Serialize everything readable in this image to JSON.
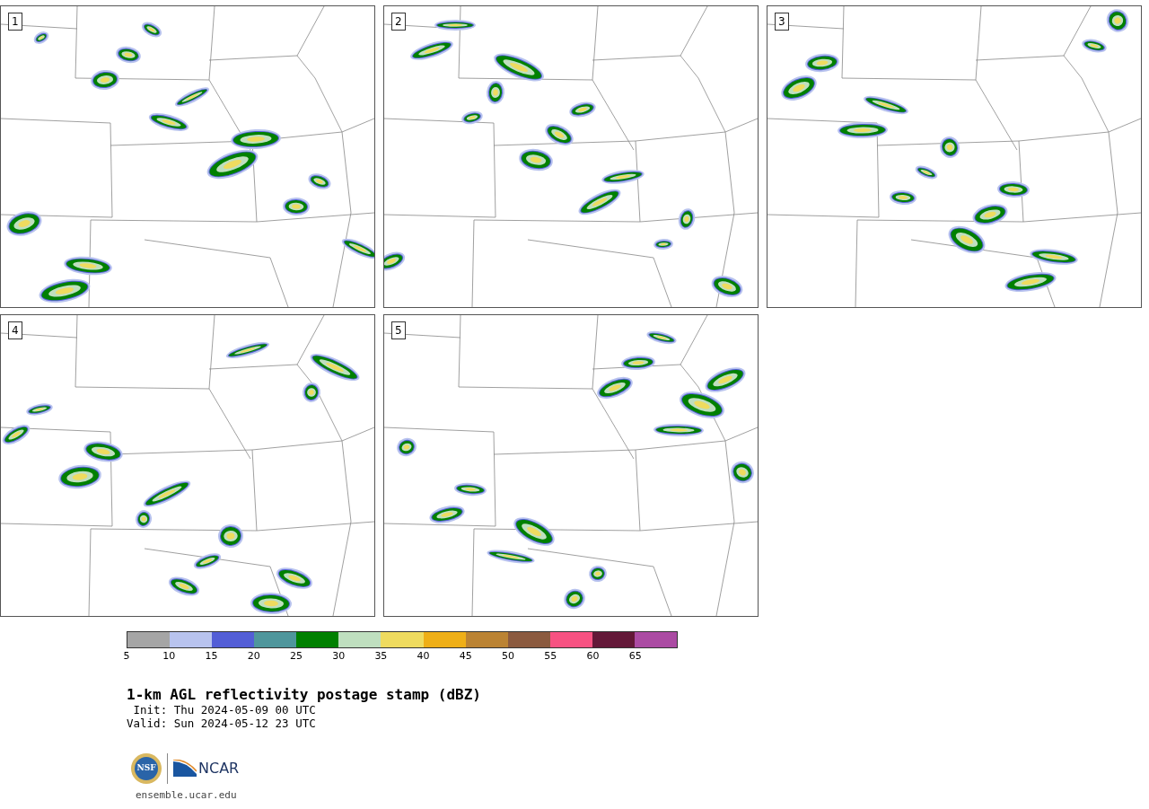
{
  "panels": [
    {
      "label": "1"
    },
    {
      "label": "2"
    },
    {
      "label": "3"
    },
    {
      "label": "4"
    },
    {
      "label": "5"
    }
  ],
  "colorbar": {
    "segments": [
      {
        "color": "#a5a5a5"
      },
      {
        "color": "#b8c3ee"
      },
      {
        "color": "#535ed6"
      },
      {
        "color": "#4f969c"
      },
      {
        "color": "#008000"
      },
      {
        "color": "#bfdfbf"
      },
      {
        "color": "#efdb5f"
      },
      {
        "color": "#efaf17"
      },
      {
        "color": "#bb8333"
      },
      {
        "color": "#8b5a3f"
      },
      {
        "color": "#f75282"
      },
      {
        "color": "#631838"
      },
      {
        "color": "#ab4ba3"
      }
    ],
    "ticks": [
      "5",
      "10",
      "15",
      "20",
      "25",
      "30",
      "35",
      "40",
      "45",
      "50",
      "55",
      "60",
      "65"
    ]
  },
  "title": "1-km AGL reflectivity postage stamp (dBZ)",
  "init": " Init: Thu 2024-05-09 00 UTC",
  "valid": "Valid: Sun 2024-05-12 23 UTC",
  "logos": {
    "nsf": "NSF",
    "ncar": "NCAR"
  },
  "url": "ensemble.ucar.edu"
}
